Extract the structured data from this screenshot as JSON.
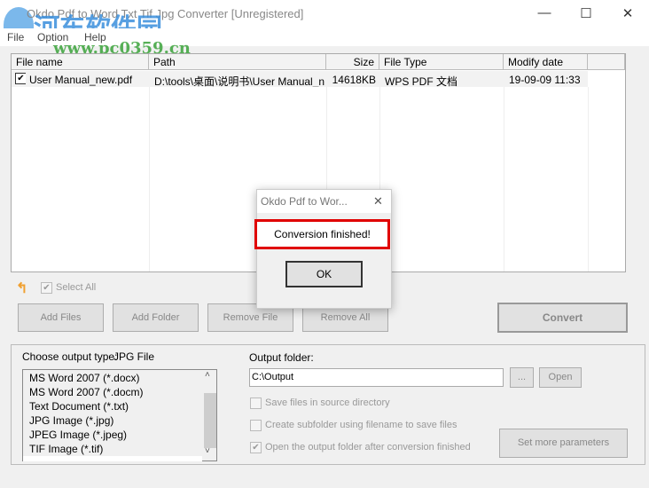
{
  "window": {
    "title": "Okdo Pdf to Word Txt Tif Jpg Converter [Unregistered]",
    "minimize": "—",
    "maximize": "☐",
    "close": "✕"
  },
  "watermark": {
    "name": "河东软件园",
    "url": "www.pc0359.cn"
  },
  "menu": [
    "File",
    "Option",
    "Help"
  ],
  "table": {
    "headers": [
      "File name",
      "Path",
      "Size",
      "File Type",
      "Modify date"
    ],
    "rows": [
      {
        "checked": true,
        "name": "User Manual_new.pdf",
        "path": "D:\\tools\\桌面\\说明书\\User Manual_n...",
        "size": "14618KB",
        "type": "WPS PDF 文档",
        "date": "19-09-09 11:33"
      }
    ]
  },
  "select_all": "Select All",
  "buttons": {
    "add_files": "Add Files",
    "add_folder": "Add Folder",
    "remove_file": "Remove File",
    "remove_all": "Remove All",
    "convert": "Convert",
    "browse": "...",
    "open": "Open",
    "more": "Set more parameters"
  },
  "output": {
    "type_label": "Choose output type:",
    "type_value": "JPG File",
    "types": [
      "MS Word 2007 (*.docx)",
      "MS Word 2007 (*.docm)",
      "Text Document (*.txt)",
      "JPG Image (*.jpg)",
      "JPEG Image (*.jpeg)",
      "TIF Image (*.tif)"
    ],
    "folder_label": "Output folder:",
    "folder_value": "C:\\Output",
    "opt_source": "Save files in source directory",
    "opt_subfolder": "Create subfolder using filename to save files",
    "opt_open": "Open the output folder after conversion finished"
  },
  "dialog": {
    "title": "Okdo Pdf to Wor...",
    "message": "Conversion finished!",
    "ok": "OK",
    "close": "✕"
  },
  "colors": {
    "highlight": "#e00000"
  }
}
